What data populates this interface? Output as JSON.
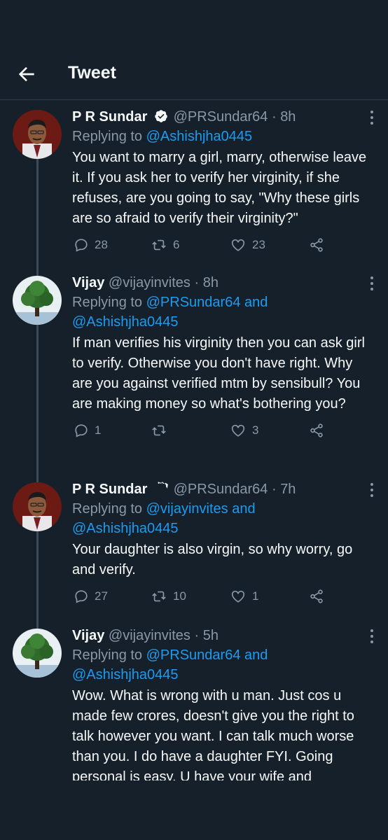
{
  "header": {
    "title": "Tweet"
  },
  "tweets": [
    {
      "name": "P R Sundar",
      "handle": "@PRSundar64",
      "time": "8h",
      "replying_prefix": "Replying to",
      "replying_to": "@Ashishjha0445",
      "text": "You want to marry a girl, marry, otherwise leave it. If you ask her to verify her virginity, if she refuses, are you going to say, \"Why these girls are so afraid to verify their virginity?\"",
      "replies": "28",
      "retweets": "6",
      "likes": "23",
      "verified": true,
      "avatar_icon": "person-portrait-icon"
    },
    {
      "name": "Vijay",
      "handle": "@vijayinvites",
      "time": "8h",
      "replying_prefix": "Replying to",
      "replying_to": "@PRSundar64",
      "replying_and": "and",
      "replying_to_2": "@Ashishjha0445",
      "text": "If man verifies his virginity then you can ask girl to verify. Otherwise you don't have right. Why are you against verified mtm by sensibull? You are making money so what's bothering you?",
      "replies": "1",
      "retweets": "",
      "likes": "3",
      "verified": false,
      "avatar_icon": "tree-icon"
    },
    {
      "name": "P R Sundar",
      "handle": "@PRSundar64",
      "time": "7h",
      "replying_prefix": "Replying to",
      "replying_to": "@vijayinvites",
      "replying_and": "and",
      "replying_to_2": "@Ashishjha0445",
      "text": "Your daughter is also virgin, so why worry, go and verify.",
      "replies": "27",
      "retweets": "10",
      "likes": "1",
      "verified": true,
      "avatar_icon": "person-portrait-icon"
    },
    {
      "name": "Vijay",
      "handle": "@vijayinvites",
      "time": "5h",
      "replying_prefix": "Replying to",
      "replying_to": "@PRSundar64",
      "replying_and": "and",
      "replying_to_2": "@Ashishjha0445",
      "text": "Wow. What is wrong with u man. Just cos u made few crores, doesn't give you the right to talk however you want. I can talk much worse than you. I do have a daughter FYI. Going personal is easy. U have your wife and",
      "verified": false,
      "avatar_icon": "tree-icon"
    }
  ],
  "colors": {
    "background": "#15202b",
    "text": "#f7f9f9",
    "secondary": "#8b98a5",
    "link": "#1d9bf0",
    "verified": "#1d9bf0"
  }
}
